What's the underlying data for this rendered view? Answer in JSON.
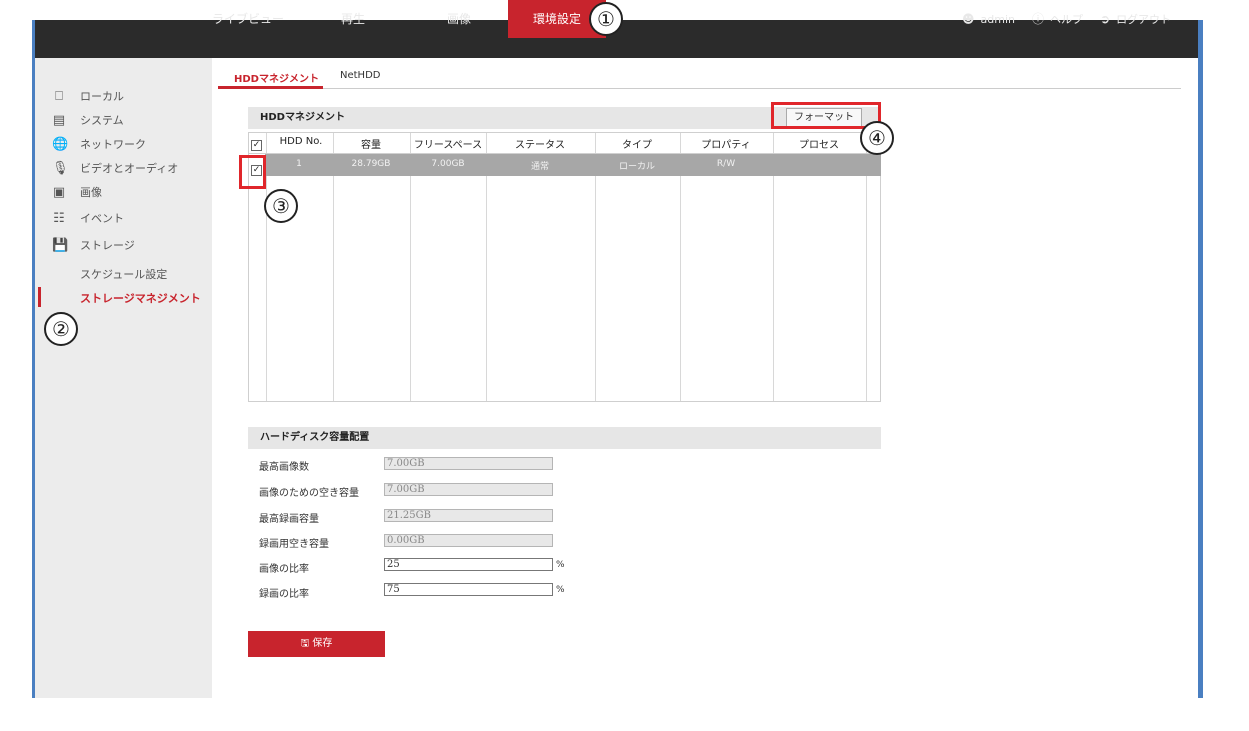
{
  "nav": {
    "items": [
      {
        "label": "ライブビュー"
      },
      {
        "label": "再生"
      },
      {
        "label": "画像"
      },
      {
        "label": "環境設定"
      }
    ],
    "user": "admin",
    "help": "ヘルプ",
    "logout": "ログアウト"
  },
  "sidebar": {
    "items": [
      {
        "label": "ローカル",
        "icon": "monitor-icon"
      },
      {
        "label": "システム",
        "icon": "system-icon"
      },
      {
        "label": "ネットワーク",
        "icon": "network-icon"
      },
      {
        "label": "ビデオとオーディオ",
        "icon": "video-audio-icon"
      },
      {
        "label": "画像",
        "icon": "image-icon"
      },
      {
        "label": "イベント",
        "icon": "event-icon"
      },
      {
        "label": "ストレージ",
        "icon": "storage-icon"
      }
    ],
    "sub_items": [
      {
        "label": "スケジュール設定"
      },
      {
        "label": "ストレージマネジメント"
      }
    ]
  },
  "tabs": [
    {
      "label": "HDDマネジメント"
    },
    {
      "label": "NetHDD"
    }
  ],
  "hdd": {
    "title": "HDDマネジメント",
    "format_button": "フォーマット",
    "columns": [
      "HDD No.",
      "容量",
      "フリースペース",
      "ステータス",
      "タイプ",
      "プロパティ",
      "プロセス"
    ],
    "rows": [
      {
        "no": "1",
        "capacity": "28.79GB",
        "free": "7.00GB",
        "status": "通常",
        "type": "ローカル",
        "property": "R/W",
        "process": ""
      }
    ]
  },
  "capacity": {
    "title": "ハードディスク容量配置",
    "fields": [
      {
        "label": "最高画像数",
        "value": "7.00GB"
      },
      {
        "label": "画像のための空き容量",
        "value": "7.00GB"
      },
      {
        "label": "最高録画容量",
        "value": "21.25GB"
      },
      {
        "label": "録画用空き容量",
        "value": "0.00GB"
      },
      {
        "label": "画像の比率",
        "value": "25"
      },
      {
        "label": "録画の比率",
        "value": "75"
      }
    ],
    "percent": "%"
  },
  "save_label": "保存",
  "badges": [
    "①",
    "②",
    "③",
    "④"
  ],
  "colors": {
    "accent": "#c8242d",
    "topbar": "#2b2b2b",
    "highlight": "#e0262b"
  }
}
